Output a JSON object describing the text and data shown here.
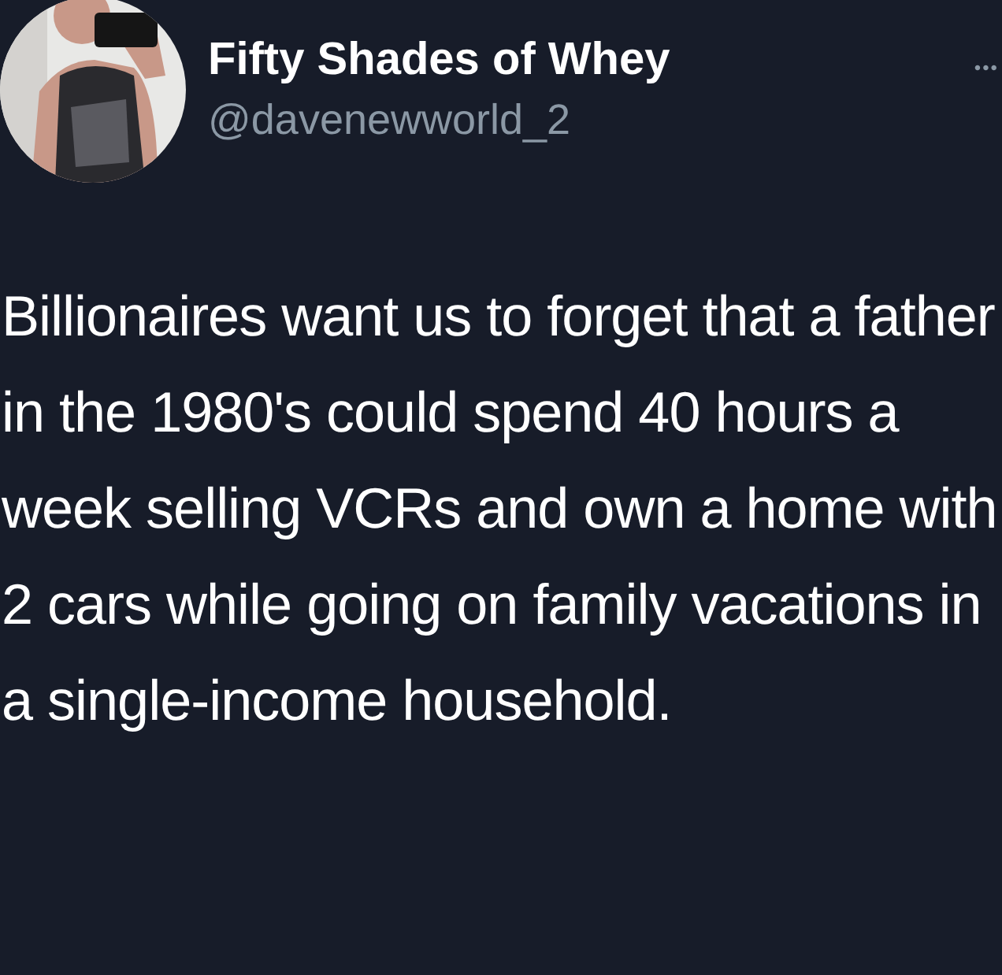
{
  "author": {
    "name": "Fifty Shades of Whey",
    "handle": "@davenewworld_2"
  },
  "menu": "•••",
  "text": "Billionaires want us to forget that a father in the 1980's could spend 40 hours a week selling VCRs and own a home with 2 cars while going on family vacations in a single-income household."
}
